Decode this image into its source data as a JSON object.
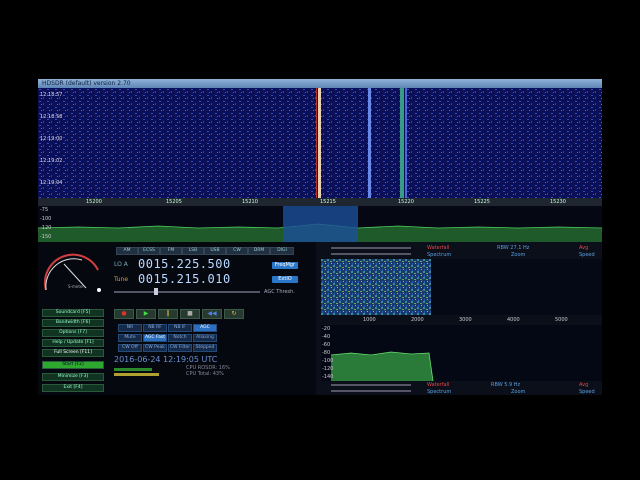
{
  "window": {
    "title": "HDSDR (default)  version 2.70"
  },
  "waterfall": {
    "times": [
      "12:18:57",
      "12:18:58",
      "12:19:00",
      "12:19:02",
      "12:19:04"
    ]
  },
  "freq_scale": {
    "labels": [
      "15200",
      "15205",
      "15210",
      "15215",
      "15220",
      "15225",
      "15230"
    ]
  },
  "spectrum": {
    "levels": [
      "-75",
      "-100",
      "-120",
      "-150"
    ]
  },
  "mode_buttons": [
    "AM",
    "ECSS",
    "FM",
    "LSB",
    "USB",
    "CW",
    "DRM",
    "DIGI"
  ],
  "lo": {
    "label": "LO A",
    "value": "0015.225.500"
  },
  "tune": {
    "label": "Tune",
    "value": "0015.215.010"
  },
  "side_buttons": {
    "freqmgr": "FreqMgr",
    "extio": "ExtIO"
  },
  "agc_label": "AGC Thresh.",
  "meter": {
    "label": "S-meter"
  },
  "left_buttons": [
    "Soundcard [F5]",
    "Bandwidth [F6]",
    "Options [F7]",
    "Help / Update [F1]",
    "Full Screen [F11]",
    "Start [F2]",
    "Minimize [F3]",
    "Exit [F4]"
  ],
  "dsp_row1": [
    "NR",
    "NB RF",
    "NB IF",
    "AGC"
  ],
  "dsp_row2": [
    "Mute",
    "AGC Fast",
    "Notch",
    "Aliasing"
  ],
  "dsp_row3": [
    "CW Off",
    "CW Peak",
    "CW Filter",
    "Stepped"
  ],
  "datetime": "2016-06-24  12:19:05 UTC",
  "cpu": {
    "line1": "CPU ROSDR: 16%",
    "line2": "CPU Total: 43%"
  },
  "zoom": {
    "top_labels": {
      "waterfall": "Waterfall",
      "rbw": "RBW 27.1 Hz",
      "avg": "Avg",
      "spectrum": "Spectrum",
      "zoom": "Zoom",
      "speed": "Speed"
    },
    "bottom_labels": {
      "waterfall": "Waterfall",
      "rbw": "RBW 5.9 Hz",
      "avg": "Avg",
      "spectrum": "Spectrum",
      "zoom": "Zoom",
      "speed": "Speed"
    },
    "x_labels": [
      "1000",
      "2000",
      "3000",
      "4000",
      "5000"
    ],
    "levels": [
      "-20",
      "-40",
      "-60",
      "-80",
      "-100",
      "-120",
      "-140"
    ]
  }
}
